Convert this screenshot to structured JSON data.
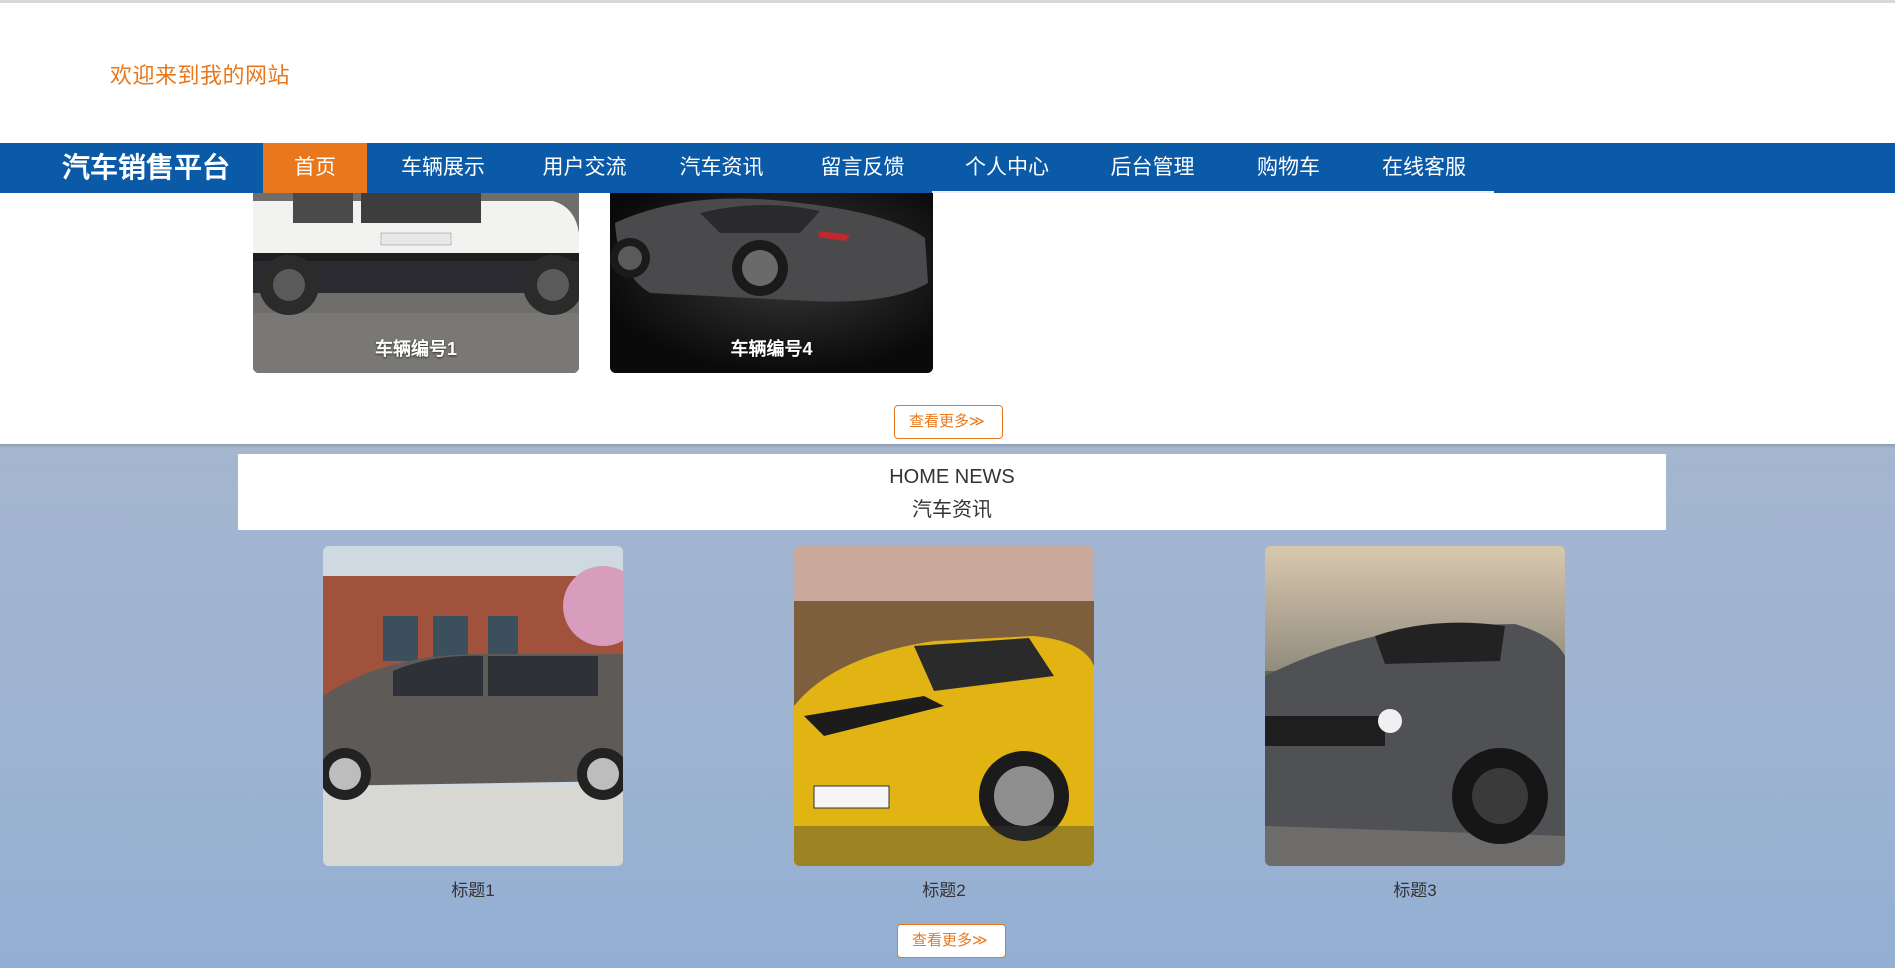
{
  "header": {
    "welcome_text": "欢迎来到我的网站"
  },
  "nav": {
    "brand": "汽车销售平台",
    "items": [
      {
        "label": "首页",
        "active": true
      },
      {
        "label": "车辆展示",
        "active": false
      },
      {
        "label": "用户交流",
        "active": false
      },
      {
        "label": "汽车资讯",
        "active": false
      },
      {
        "label": "留言反馈",
        "active": false
      },
      {
        "label": "个人中心",
        "active": false
      },
      {
        "label": "后台管理",
        "active": false
      },
      {
        "label": "购物车",
        "active": false
      },
      {
        "label": "在线客服",
        "active": false
      }
    ]
  },
  "vehicles": {
    "cards": [
      {
        "label": "车辆编号1"
      },
      {
        "label": "车辆编号4"
      }
    ],
    "more_label": "查看更多≫"
  },
  "news": {
    "heading_en": "HOME NEWS",
    "heading_zh": "汽车资讯",
    "cards": [
      {
        "title": "标题1"
      },
      {
        "title": "标题2"
      },
      {
        "title": "标题3"
      }
    ],
    "more_label": "查看更多≫"
  },
  "colors": {
    "accent": "#e9771b",
    "nav_bg": "#0a5aa8"
  }
}
